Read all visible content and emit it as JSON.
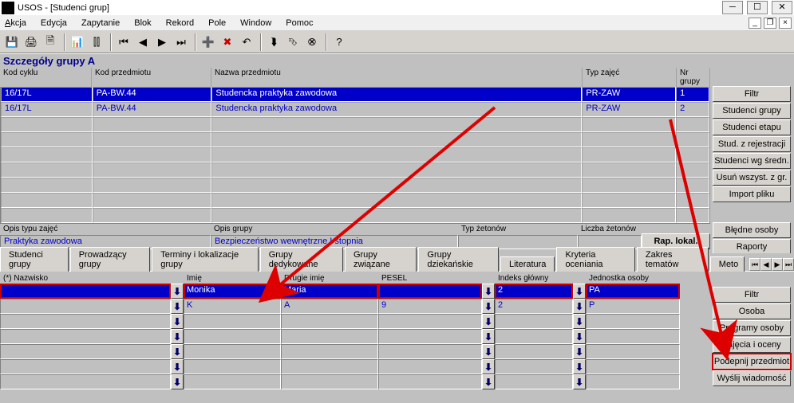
{
  "window": {
    "title": "USOS - [Studenci grup]"
  },
  "menu": {
    "akcja": "Akcja",
    "edycja": "Edycja",
    "zapytanie": "Zapytanie",
    "blok": "Blok",
    "rekord": "Rekord",
    "pole": "Pole",
    "window": "Window",
    "pomoc": "Pomoc"
  },
  "panel": {
    "title": "Szczegóły grupy  A"
  },
  "grid1": {
    "headers": {
      "kod": "Kod cyklu",
      "kodp": "Kod przedmiotu",
      "nazwa": "Nazwa przedmiotu",
      "typ": "Typ zajęć",
      "nr": "Nr grupy"
    },
    "rows": [
      {
        "kod": "16/17L",
        "kodp": "PA-BW.44",
        "nazwa": "Studencka praktyka zawodowa",
        "typ": "PR-ZAW",
        "nr": "1"
      },
      {
        "kod": "16/17L",
        "kodp": "PA-BW.44",
        "nazwa": "Studencka praktyka zawodowa",
        "typ": "PR-ZAW",
        "nr": "2"
      }
    ]
  },
  "meta": {
    "opis_typu_lbl": "Opis typu zajęć",
    "opis_typu_val": "Praktyka zawodowa",
    "opis_grupy_lbl": "Opis grupy",
    "opis_grupy_val": "Bezpieczeństwo wewnętrzne I stopnia",
    "typ_zet_lbl": "Typ żetonów",
    "typ_zet_val": "",
    "liczba_zet_lbl": "Liczba żetonów",
    "liczba_zet_val": "",
    "rap_btn": "Rap. lokal. BIRT"
  },
  "side_top": {
    "filtr": "Filtr",
    "stud_grupy": "Studenci grupy",
    "stud_etapu": "Studenci etapu",
    "stud_rej": "Stud. z rejestracji",
    "stud_sred": "Studenci wg średn.",
    "usun": "Usuń wszyst. z gr.",
    "import": "Import pliku",
    "bledne": "Błędne osoby",
    "raporty": "Raporty"
  },
  "tabs": {
    "studenci": "Studenci grupy",
    "prowadzacy": "Prowadzący grupy",
    "terminy": "Terminy i lokalizacje grupy",
    "dedykowane": "Grupy dedykowane",
    "zwiazane": "Grupy związane",
    "dziekanskie": "Grupy dziekańskie",
    "literatura": "Literatura",
    "kryteria": "Kryteria oceniania",
    "zakres": "Zakres tematów",
    "metody": "Meto"
  },
  "students": {
    "headers": {
      "nazw": "(*) Nazwisko",
      "imie": "Imię",
      "drugie": "Drugie imię",
      "pesel": "PESEL",
      "indeks": "Indeks główny",
      "jedn": "Jednostka osoby"
    },
    "rows": [
      {
        "nazw": "",
        "imie": "Monika",
        "drugie": "Maria",
        "pesel": "",
        "indeks": "2",
        "jedn": "PA"
      },
      {
        "nazw": "",
        "imie": "K",
        "drugie": "A",
        "pesel": "9",
        "indeks": "2",
        "jedn": "P"
      }
    ]
  },
  "side_bottom": {
    "filtr": "Filtr",
    "osoba": "Osoba",
    "programy": "Programy osoby",
    "zajecia": "Zajęcia i oceny",
    "podepnij": "Podepnij przedmiot",
    "wyslij": "Wyślij wiadomość"
  }
}
